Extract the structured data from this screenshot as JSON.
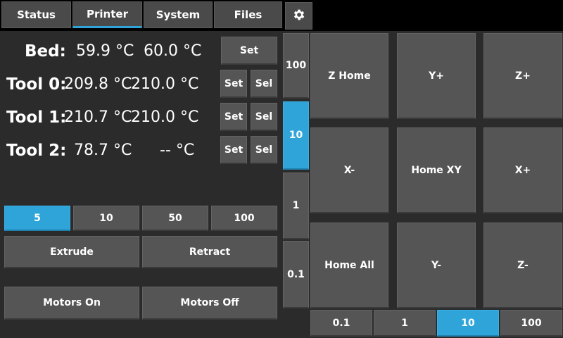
{
  "tabs": [
    {
      "label": "Status"
    },
    {
      "label": "Printer"
    },
    {
      "label": "System"
    },
    {
      "label": "Files"
    }
  ],
  "active_tab": "Printer",
  "temps": {
    "bed": {
      "label": "Bed:",
      "actual": "59.9 °C",
      "target": "60.0 °C",
      "set": "Set"
    },
    "tool0": {
      "label": "Tool 0:",
      "actual": "209.8 °C",
      "target": "210.0 °C",
      "set": "Set",
      "sel": "Sel"
    },
    "tool1": {
      "label": "Tool 1:",
      "actual": "210.7 °C",
      "target": "210.0 °C",
      "set": "Set",
      "sel": "Sel"
    },
    "tool2": {
      "label": "Tool 2:",
      "actual": "78.7 °C",
      "target": "-- °C",
      "set": "Set",
      "sel": "Sel"
    }
  },
  "extrude_amounts": [
    "5",
    "10",
    "50",
    "100"
  ],
  "extrude_selected": "5",
  "actions": {
    "extrude": "Extrude",
    "retract": "Retract",
    "motors_on": "Motors On",
    "motors_off": "Motors Off"
  },
  "z_steps": [
    "100",
    "10",
    "1",
    "0.1"
  ],
  "z_selected": "10",
  "jog": {
    "z_home": "Z Home",
    "y_plus": "Y+",
    "z_plus": "Z+",
    "x_minus": "X-",
    "home_xy": "Home XY",
    "x_plus": "X+",
    "home_all": "Home All",
    "y_minus": "Y-",
    "z_minus": "Z-"
  },
  "xy_steps": [
    "0.1",
    "1",
    "10",
    "100"
  ],
  "xy_selected": "10",
  "colors": {
    "accent": "#2fa4d9",
    "button": "#555555",
    "panel": "#2b2b2b"
  },
  "icons": {
    "settings": "gear-icon"
  }
}
